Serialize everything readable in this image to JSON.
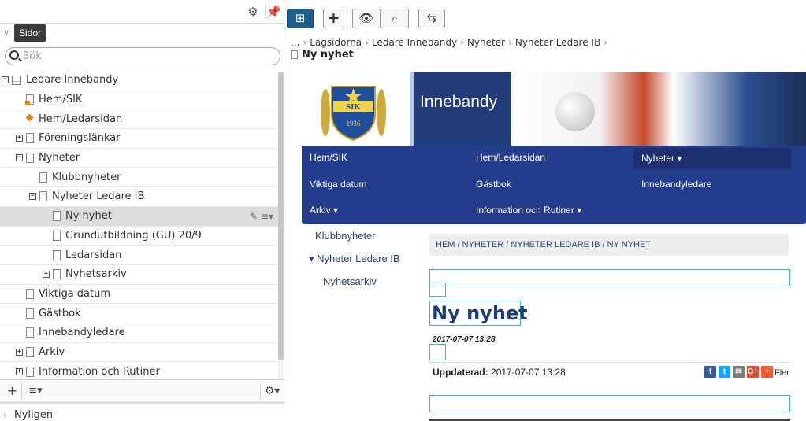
{
  "sidebar": {
    "section_title": "Sidor",
    "search_placeholder": "Sök",
    "tree": [
      {
        "label": "Ledare Innebandy",
        "level": 0,
        "expander": "−"
      },
      {
        "label": "Hem/SIK",
        "level": 1
      },
      {
        "label": "Hem/Ledarsidan",
        "level": 1
      },
      {
        "label": "Föreningslänkar",
        "level": 1,
        "expander": "+"
      },
      {
        "label": "Nyheter",
        "level": 1,
        "expander": "−"
      },
      {
        "label": "Klubbnyheter",
        "level": 2
      },
      {
        "label": "Nyheter Ledare IB",
        "level": 2,
        "expander": "−"
      },
      {
        "label": "Ny nyhet",
        "level": 3,
        "selected": true
      },
      {
        "label": "Grundutbildning (GU) 20/9",
        "level": 3
      },
      {
        "label": "Ledarsidan",
        "level": 3
      },
      {
        "label": "Nyhetsarkiv",
        "level": 3,
        "expander": "+"
      },
      {
        "label": "Viktiga datum",
        "level": 1
      },
      {
        "label": "Gästbok",
        "level": 1
      },
      {
        "label": "Innebandyledare",
        "level": 1
      },
      {
        "label": "Arkiv",
        "level": 1,
        "expander": "+"
      },
      {
        "label": "Information och Rutiner",
        "level": 1,
        "expander": "+"
      }
    ],
    "recent_label": "Nyligen"
  },
  "toolbar": {
    "add_label": "+"
  },
  "breadcrumb": {
    "items": [
      "...",
      "Lagsidorna",
      "Ledare Innebandy",
      "Nyheter",
      "Nyheter Ledare IB"
    ],
    "current": "Ny nyhet"
  },
  "site": {
    "banner_title": "Innebandy",
    "logo_text": "SIK",
    "logo_year": "1936",
    "nav": [
      {
        "label": "Hem/SIK"
      },
      {
        "label": "Hem/Ledarsidan"
      },
      {
        "label": "Nyheter ▾",
        "active": true
      },
      {
        "label": "Viktiga datum"
      },
      {
        "label": "Gästbok"
      },
      {
        "label": "Innebandyledare"
      },
      {
        "label": "Arkiv ▾"
      },
      {
        "label": "Information och Rutiner ▾"
      }
    ],
    "subnav": [
      {
        "label": "Klubbnyheter"
      },
      {
        "label": "▾  Nyheter Ledare IB"
      },
      {
        "label": "Nyhetsarkiv"
      }
    ],
    "page_breadcrumb": "HEM / NYHETER / NYHETER LEDARE IB / NY NYHET",
    "heading": "Ny nyhet",
    "post_date": "2017-07-07 13:28",
    "updated_label": "Uppdaterad:",
    "updated_value": "2017-07-07 13:28",
    "share": [
      {
        "icon": "facebook-icon",
        "glyph": "f",
        "color": "#3b5998"
      },
      {
        "icon": "twitter-icon",
        "glyph": "t",
        "color": "#1da1f2"
      },
      {
        "icon": "email-icon",
        "glyph": "✉",
        "color": "#7d7d7d"
      },
      {
        "icon": "googleplus-icon",
        "glyph": "G+",
        "color": "#dd4b39"
      },
      {
        "icon": "more-share-icon",
        "glyph": "+",
        "color": "#f05a30"
      }
    ],
    "share_more_label": "Fler"
  },
  "colors": {
    "nav_bg": "#243c8c",
    "accent": "#1f5f8b",
    "edit_outline": "#38b8d0"
  }
}
